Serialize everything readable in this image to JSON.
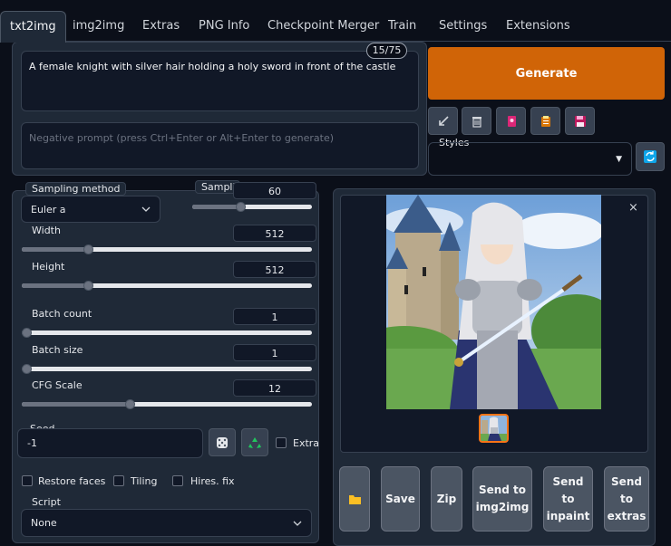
{
  "tabs": [
    "txt2img",
    "img2img",
    "Extras",
    "PNG Info",
    "Checkpoint Merger",
    "Train",
    "Settings",
    "Extensions"
  ],
  "prompt": {
    "value": "A female knight with silver hair holding a holy sword in front of the castle",
    "token_counter": "15/75",
    "negative_placeholder": "Negative prompt (press Ctrl+Enter or Alt+Enter to generate)"
  },
  "generate_label": "Generate",
  "tool_icons": [
    "arrow-icon",
    "trash-icon",
    "book-icon",
    "clipboard-icon",
    "floppy-icon"
  ],
  "styles": {
    "label": "Styles",
    "value": ""
  },
  "sampling": {
    "method_label": "Sampling method",
    "method_value": "Euler a",
    "steps_label": "Sampling steps",
    "steps_value": "60"
  },
  "sliders": [
    {
      "label": "Width",
      "value": "512",
      "fraction": 0.22
    },
    {
      "label": "Height",
      "value": "512",
      "fraction": 0.22
    },
    {
      "label": "Batch count",
      "value": "1",
      "fraction": 0.0
    },
    {
      "label": "Batch size",
      "value": "1",
      "fraction": 0.0
    },
    {
      "label": "CFG Scale",
      "value": "12",
      "fraction": 0.37
    }
  ],
  "steps_fraction": 0.4,
  "seed": {
    "label": "Seed",
    "value": "-1",
    "extra_label": "Extra"
  },
  "options": {
    "restore_faces": "Restore faces",
    "tiling": "Tiling",
    "hires_fix": "Hires. fix"
  },
  "script": {
    "label": "Script",
    "value": "None"
  },
  "actions": {
    "folder_icon": "folder-icon",
    "save": "Save",
    "zip": "Zip",
    "send_img2img": "Send to img2img",
    "send_inpaint": "Send to inpaint",
    "send_extras": "Send to extras"
  },
  "gallery": {
    "close": "×"
  },
  "colors": {
    "accent": "#d06407",
    "background": "#0b0f19",
    "panel": "#1f2937"
  }
}
